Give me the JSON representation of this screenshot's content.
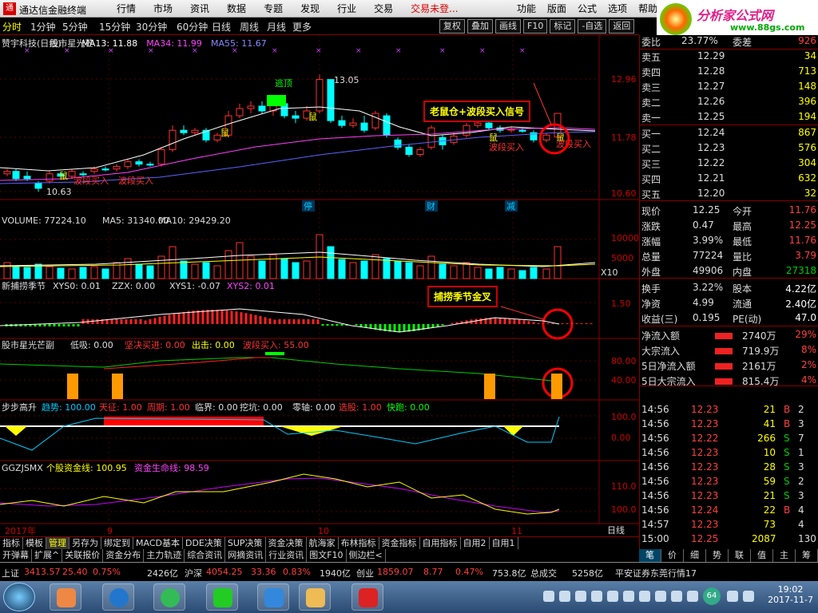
{
  "titlebar": {
    "app_title": "通达信金融终端",
    "logo_text": "通",
    "menus": [
      "行情",
      "市场",
      "资讯",
      "数据",
      "专题",
      "发现",
      "行业",
      "交易"
    ],
    "login_status": "交易未登...",
    "right_menus": [
      "功能",
      "版面",
      "公式",
      "选项",
      "帮助"
    ]
  },
  "brand": {
    "name": "分析家公式网",
    "url": "www.88gs.com"
  },
  "periods": [
    "分时",
    "1分钟",
    "5分钟",
    "15分钟",
    "30分钟",
    "60分钟",
    "日线",
    "周线",
    "月线",
    "更多"
  ],
  "toolbar": [
    "复权",
    "叠加",
    "画线",
    "F10",
    "标记",
    "-自选",
    "返回"
  ],
  "main_chart": {
    "stock": "赞宇科技(日线)",
    "indicator": "股市星光芒",
    "ma13": "MA13: 11.88",
    "ma34": "MA34: 11.99",
    "ma55": "MA55: 11.67",
    "y_labels": [
      "12.96",
      "11.78",
      "10.60"
    ],
    "high_label": "13.05",
    "low_label": "10.63",
    "label_escape": "逃顶",
    "label_mouse": "鼠",
    "label_wave_buy": "波段买入",
    "markers": [
      "停",
      "财",
      "减"
    ],
    "callout": "老鼠仓+波段买入信号"
  },
  "volume": {
    "label": "VOLUME: 77224.10",
    "ma5": "MA5: 31340.00",
    "ma10": "MA10: 29429.20",
    "y_labels": [
      "10000",
      "5000"
    ],
    "unit": "X10"
  },
  "sub1": {
    "name": "新捕捞季节",
    "xys0": "XYS0: 0.01",
    "zzx": "ZZX: 0.00",
    "xys1": "XYS1: -0.07",
    "xys2": "XYS2: 0.01",
    "y_label": "1.50",
    "callout": "捕捞季节金叉"
  },
  "sub2": {
    "name": "股市星光芒副",
    "low_buy": "低吸: 0.00",
    "firm_in": "坚决买进: 0.00",
    "out": "出击: 0.00",
    "wave_buy": "波段买入: 55.00",
    "y_labels": [
      "80.00",
      "40.00"
    ]
  },
  "sub3": {
    "name": "步步高升",
    "trend": "趋势: 100.00",
    "sky": "天征: 1.00",
    "cycle": "周期: 1.00",
    "critical": "临界: 0.00",
    "dig": "挖坑: 0.00",
    "zero": "零轴: 0.00",
    "sell": "选股: 1.00",
    "fast": "快跑: 0.00",
    "y_labels": [
      "100.0",
      "0.00"
    ]
  },
  "sub4": {
    "name": "GGZJSMX",
    "line1": "个股资金线: 100.95",
    "line2": "资金生命线: 98.59",
    "y_labels": [
      "110.0",
      "100.0"
    ]
  },
  "xaxis": {
    "labels": [
      "2017年",
      "9",
      "10",
      "11"
    ],
    "period": "日线"
  },
  "quote": {
    "wei_bi": {
      "label": "委比",
      "value": "23.77%",
      "label2": "委差",
      "value2": "926"
    },
    "asks": [
      {
        "label": "卖五",
        "price": "12.29",
        "vol": "34"
      },
      {
        "label": "卖四",
        "price": "12.28",
        "vol": "713"
      },
      {
        "label": "卖三",
        "price": "12.27",
        "vol": "148"
      },
      {
        "label": "卖二",
        "price": "12.26",
        "vol": "396"
      },
      {
        "label": "卖一",
        "price": "12.25",
        "vol": "194"
      }
    ],
    "bids": [
      {
        "label": "买一",
        "price": "12.24",
        "vol": "867"
      },
      {
        "label": "买二",
        "price": "12.23",
        "vol": "576"
      },
      {
        "label": "买三",
        "price": "12.22",
        "vol": "304"
      },
      {
        "label": "买四",
        "price": "12.21",
        "vol": "632"
      },
      {
        "label": "买五",
        "price": "12.20",
        "vol": "32"
      }
    ],
    "stats": [
      [
        "现价",
        "12.25",
        "今开",
        "11.76"
      ],
      [
        "涨跌",
        "0.47",
        "最高",
        "12.25"
      ],
      [
        "涨幅",
        "3.99%",
        "最低",
        "11.76"
      ],
      [
        "总量",
        "77224",
        "量比",
        "3.79"
      ],
      [
        "外盘",
        "49906",
        "内盘",
        "27318"
      ]
    ],
    "fund": [
      [
        "换手",
        "3.22%",
        "股本",
        "4.22亿"
      ],
      [
        "净资",
        "4.99",
        "流通",
        "2.40亿"
      ],
      [
        "收益(三)",
        "0.195",
        "PE(动)",
        "47.0"
      ]
    ],
    "flows": [
      [
        "净流入额",
        "2740万",
        "29%"
      ],
      [
        "大宗流入",
        "719.9万",
        "8%"
      ],
      [
        "5日净流入额",
        "2161万",
        "2%"
      ],
      [
        "5日大宗流入",
        "815.4万",
        "4%"
      ]
    ]
  },
  "ticks": [
    [
      "14:56",
      "12.23",
      "21",
      "B",
      "2"
    ],
    [
      "14:56",
      "12.23",
      "41",
      "B",
      "3"
    ],
    [
      "14:56",
      "12.22",
      "266",
      "S",
      "7"
    ],
    [
      "14:56",
      "12.23",
      "10",
      "S",
      "1"
    ],
    [
      "14:56",
      "12.23",
      "28",
      "S",
      "3"
    ],
    [
      "14:56",
      "12.23",
      "59",
      "S",
      "2"
    ],
    [
      "14:56",
      "12.23",
      "21",
      "S",
      "3"
    ],
    [
      "14:56",
      "12.24",
      "22",
      "B",
      "4"
    ],
    [
      "14:57",
      "12.23",
      "73",
      "",
      "4"
    ],
    [
      "15:00",
      "12.25",
      "2087",
      "",
      "130"
    ]
  ],
  "bottom_tabs1": [
    "指标",
    "模板",
    "管理",
    "另存为",
    "绑定到",
    "MACD基本",
    "DDE决策",
    "SUP决策",
    "资金决策",
    "航海家",
    "布林指标",
    "资金指标",
    "自用指标",
    "自用2",
    "自用1"
  ],
  "bottom_tabs2": [
    "开弹幕",
    "扩展^",
    "关联报价",
    "资金分布",
    "主力轨迹",
    "综合资讯",
    "网摘资讯",
    "行业资讯",
    "图文F10",
    "侧边栏<"
  ],
  "side_tabs": [
    "笔",
    "价",
    "细",
    "势",
    "联",
    "值",
    "主",
    "筹"
  ],
  "status": {
    "sh_label": "上证",
    "sh_idx": "3413.57",
    "sh_chg": "25.40",
    "sh_pct": "0.75%",
    "sh_amt": "2426亿",
    "sz_label": "沪深",
    "sz_idx": "4054.25",
    "sz_chg": "33.36",
    "sz_pct": "0.83%",
    "sz_amt": "1940亿",
    "cy_label": "创业",
    "cy_idx": "1859.07",
    "cy_chg": "8.77",
    "cy_pct": "0.47%",
    "cy_amt": "753.8亿",
    "total_label": "总成交",
    "total": "5258亿",
    "broker": "平安证券东莞行情17"
  },
  "taskbar": {
    "time": "19:02",
    "date": "2017-11-7",
    "badge": "64"
  },
  "colors": {
    "up": "#ff3030",
    "down": "#00ffff",
    "ma13": "#ffffff",
    "ma34": "#ff40ff",
    "ma55": "#6060ff",
    "highlight": "#ff0000"
  }
}
